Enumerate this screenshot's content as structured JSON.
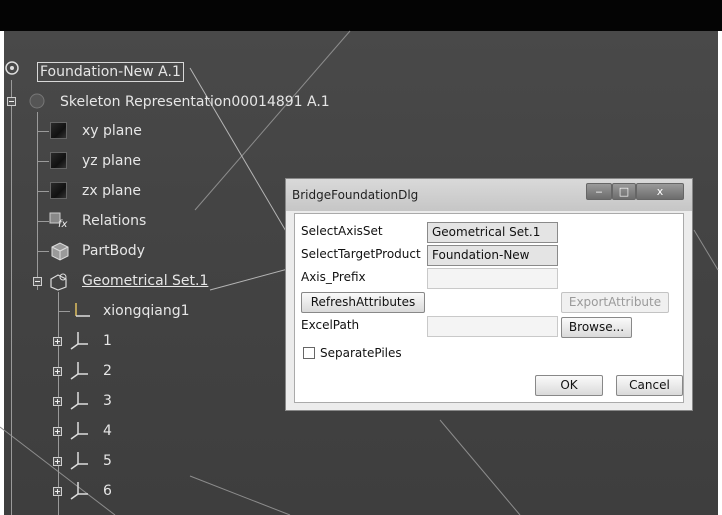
{
  "tree": {
    "root": "Foundation-New A.1",
    "skeleton": "Skeleton Representation00014891 A.1",
    "xy_plane": "xy plane",
    "yz_plane": "yz plane",
    "zx_plane": "zx plane",
    "relations": "Relations",
    "partbody": "PartBody",
    "geometrical_set": "Geometrical Set.1",
    "axis_item": "xiongqiang1",
    "axis_nodes": [
      "1",
      "2",
      "3",
      "4",
      "5",
      "6"
    ]
  },
  "dialog": {
    "title": "BridgeFoundationDlg",
    "window_controls": {
      "minimize": "‒",
      "maximize": "□",
      "close": "x"
    },
    "select_axis_set_label": "SelectAxisSet",
    "select_axis_set_value": "Geometrical Set.1",
    "select_target_product_label": "SelectTargetProduct",
    "select_target_product_value": "Foundation-New",
    "axis_prefix_label": "Axis_Prefix",
    "axis_prefix_value": "",
    "refresh_button": "RefreshAttributes",
    "export_button": "ExportAttribute",
    "excel_path_label": "ExcelPath",
    "excel_path_value": "",
    "browse_button": "Browse...",
    "separate_piles_label": "SeparatePiles",
    "separate_piles_checked": false,
    "ok_button": "OK",
    "cancel_button": "Cancel"
  }
}
